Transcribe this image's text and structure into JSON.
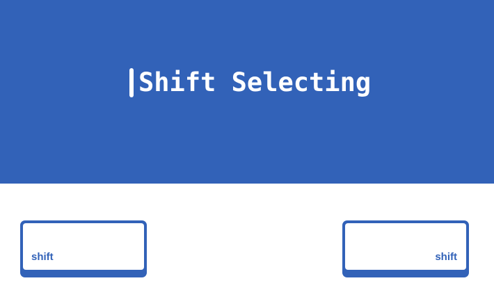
{
  "header": {
    "title": "Shift Selecting"
  },
  "keys": [
    {
      "label": "shift",
      "side": "left"
    },
    {
      "label": "shift",
      "side": "right"
    }
  ],
  "colors": {
    "brand_blue": "#3262b8",
    "background": "#ffffff",
    "text_on_blue": "#ffffff"
  }
}
